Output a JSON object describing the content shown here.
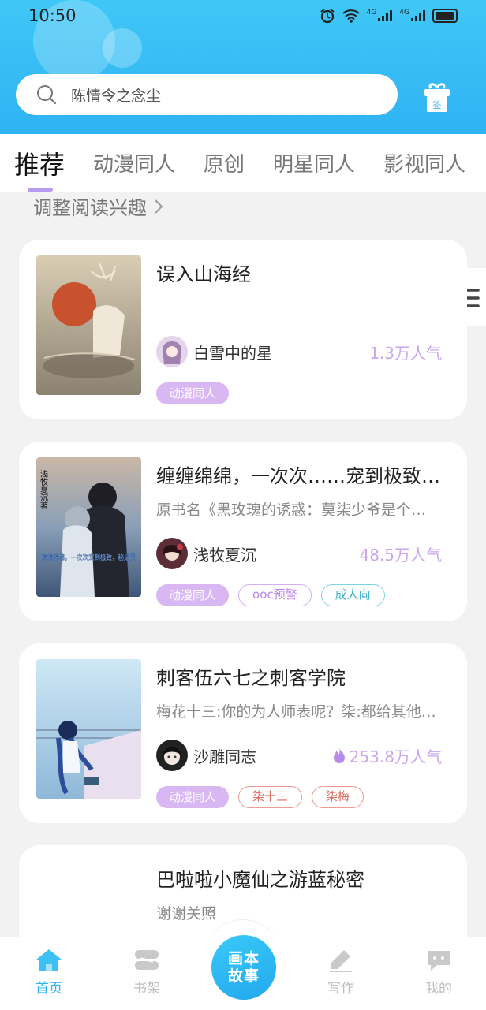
{
  "status_bar": {
    "time": "10:50",
    "network_label_1": "4G",
    "network_label_2": "4G"
  },
  "search": {
    "placeholder": "陈情令之念尘"
  },
  "gift": {
    "label": "签"
  },
  "tabs": [
    {
      "label": "推荐",
      "active": true
    },
    {
      "label": "动漫同人"
    },
    {
      "label": "原创"
    },
    {
      "label": "明星同人"
    },
    {
      "label": "影视同人"
    }
  ],
  "interest_link": {
    "label": "调整阅读兴趣"
  },
  "books": [
    {
      "title": "误入山海经",
      "author": "白雪中的星",
      "popularity": "1.3万人气",
      "tags": [
        {
          "label": "动漫同人",
          "style": "purple"
        }
      ]
    },
    {
      "title": "缠缠绵绵，一次次……宠到极致，秘",
      "description": "原书名《黑玫瑰的诱惑：莫柒少爷是个…",
      "author": "浅牧夏沉",
      "popularity": "48.5万人气",
      "tags": [
        {
          "label": "动漫同人",
          "style": "purple"
        },
        {
          "label": "ooc预警",
          "style": "outline-purple"
        },
        {
          "label": "成人向",
          "style": "outline-cyan"
        }
      ],
      "cover_text_top": "浅牧夏沉著",
      "cover_text_bottom": "缠缠绵绵，一次次宠到极致，秘是爱"
    },
    {
      "title": "刺客伍六七之刺客学院",
      "description": "梅花十三:你的为人师表呢？柒:都给其他…",
      "author": "沙雕同志",
      "popularity": "253.8万人气",
      "hot": true,
      "tags": [
        {
          "label": "动漫同人",
          "style": "purple"
        },
        {
          "label": "柒十三",
          "style": "outline-red"
        },
        {
          "label": "柒梅",
          "style": "outline-red"
        }
      ]
    },
    {
      "title": "巴啦啦小魔仙之游蓝秘密",
      "description": "谢谢关照"
    }
  ],
  "bottom_nav": {
    "home": "首页",
    "bookshelf": "书架",
    "center_line1": "画本",
    "center_line2": "故事",
    "write": "写作",
    "mine": "我的"
  },
  "colors": {
    "accent": "#2fb3f3",
    "tag_purple": "#d8b7f2",
    "popularity": "#c9a6ee"
  }
}
